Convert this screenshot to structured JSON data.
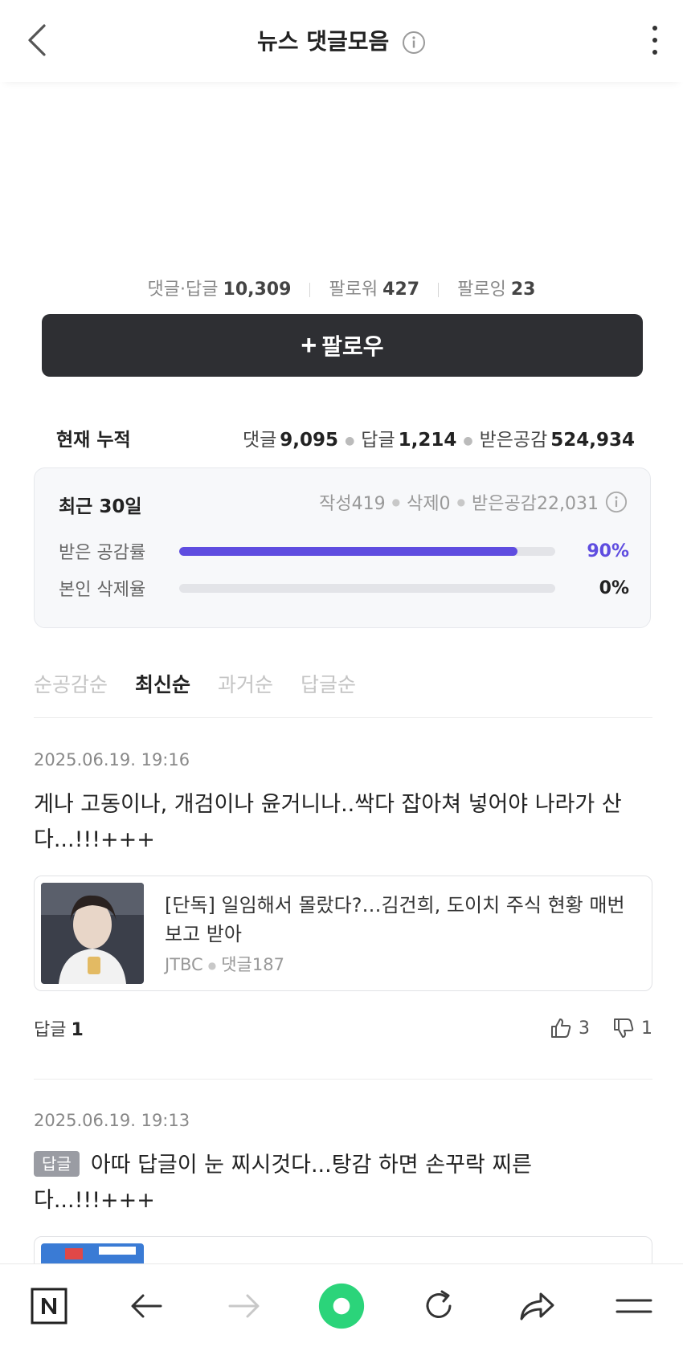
{
  "header": {
    "title": "뉴스 댓글모음"
  },
  "profile": {
    "stats": [
      {
        "label": "댓글·답글",
        "value": "10,309"
      },
      {
        "label": "팔로워",
        "value": "427"
      },
      {
        "label": "팔로잉",
        "value": "23"
      }
    ],
    "follow_label": "팔로우"
  },
  "cumulative": {
    "label": "현재 누적",
    "comments_label": "댓글",
    "comments_value": "9,095",
    "replies_label": "답글",
    "replies_value": "1,214",
    "likes_label": "받은공감",
    "likes_value": "524,934"
  },
  "recent": {
    "title": "최근 30일",
    "written": "작성419",
    "deleted": "삭제0",
    "likes": "받은공감22,031",
    "empathy_label": "받은 공감률",
    "empathy_value": "90%",
    "empathy_percent": 90,
    "delete_label": "본인 삭제율",
    "delete_value": "0%",
    "delete_percent": 0
  },
  "sort_tabs": [
    "순공감순",
    "최신순",
    "과거순",
    "답글순"
  ],
  "active_sort": 1,
  "comments": [
    {
      "date": "2025.06.19. 19:16",
      "text": "게나 고동이나, 개검이나 윤거니나..싹다 잡아쳐 넣어야 나라가 산다...!!!+++",
      "article_title": "[단독] 일임해서 몰랐다?…김건희, 도이치 주식 현황 매번 보고 받아",
      "article_source": "JTBC",
      "article_comments": "댓글187",
      "reply_label": "답글",
      "reply_count": "1",
      "likes": "3",
      "dislikes": "1"
    },
    {
      "date": "2025.06.19. 19:13",
      "badge": "답글",
      "text": "아따 답글이 눈 찌시것다...탕감 하면 손꾸락 찌른다...!!!+++"
    }
  ],
  "icons": {
    "back": "chevron-left-icon",
    "info": "info-icon",
    "more": "more-vertical-icon",
    "like": "thumbs-up-icon",
    "dislike": "thumbs-down-icon",
    "toolbar": [
      "naver-home-icon",
      "arrow-left-icon",
      "arrow-right-icon",
      "green-dot-icon",
      "refresh-icon",
      "share-icon",
      "menu-icon"
    ]
  },
  "colors": {
    "accent": "#5f4de0",
    "follow_button": "#2e2f33",
    "green": "#2bd47a"
  }
}
